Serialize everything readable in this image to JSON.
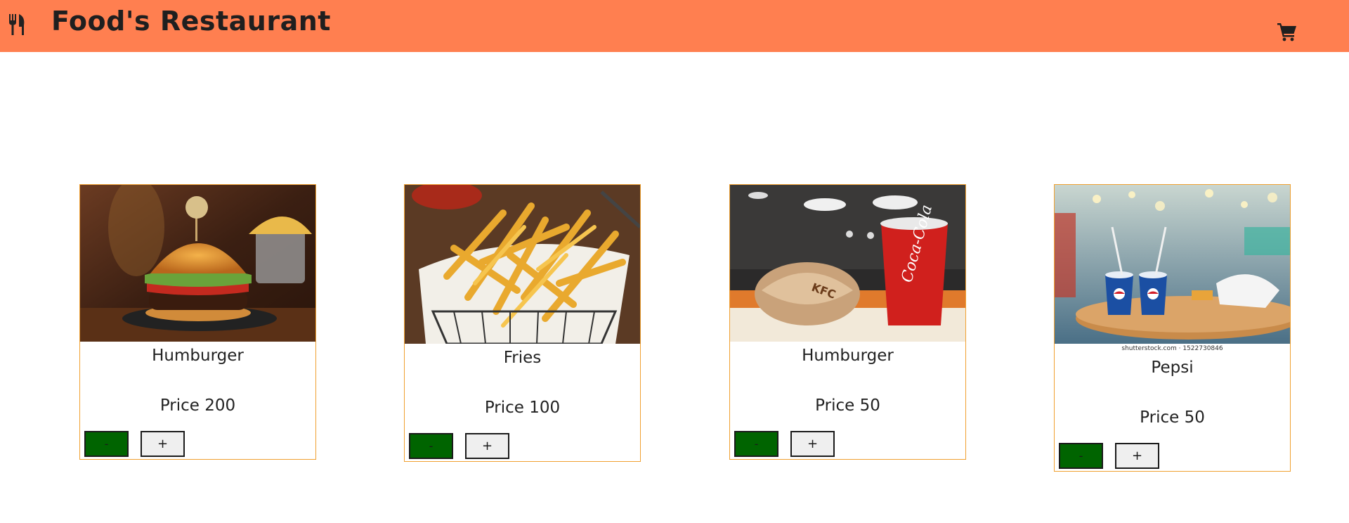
{
  "header": {
    "title": "Food's Restaurant",
    "brand_icon": "utensils-icon",
    "cart_icon": "shopping-cart-icon",
    "background_color": "#ff7f50"
  },
  "products": [
    {
      "name": "Humburger",
      "price": "Price 200",
      "image": "burger-photo",
      "minus_label": "-",
      "plus_label": "+"
    },
    {
      "name": "Fries",
      "price": "Price 100",
      "image": "fries-photo",
      "minus_label": "-",
      "plus_label": "+"
    },
    {
      "name": "Humburger",
      "price": "Price 50",
      "image": "kfc-meal-photo",
      "minus_label": "-",
      "plus_label": "+"
    },
    {
      "name": "Pepsi",
      "price": "Price 50",
      "image": "pepsi-photo",
      "image_caption": "shutterstock.com · 1522730846",
      "minus_label": "-",
      "plus_label": "+"
    }
  ],
  "colors": {
    "card_border": "#f0a030",
    "minus_button": "#006400",
    "plus_button": "#efefef"
  }
}
